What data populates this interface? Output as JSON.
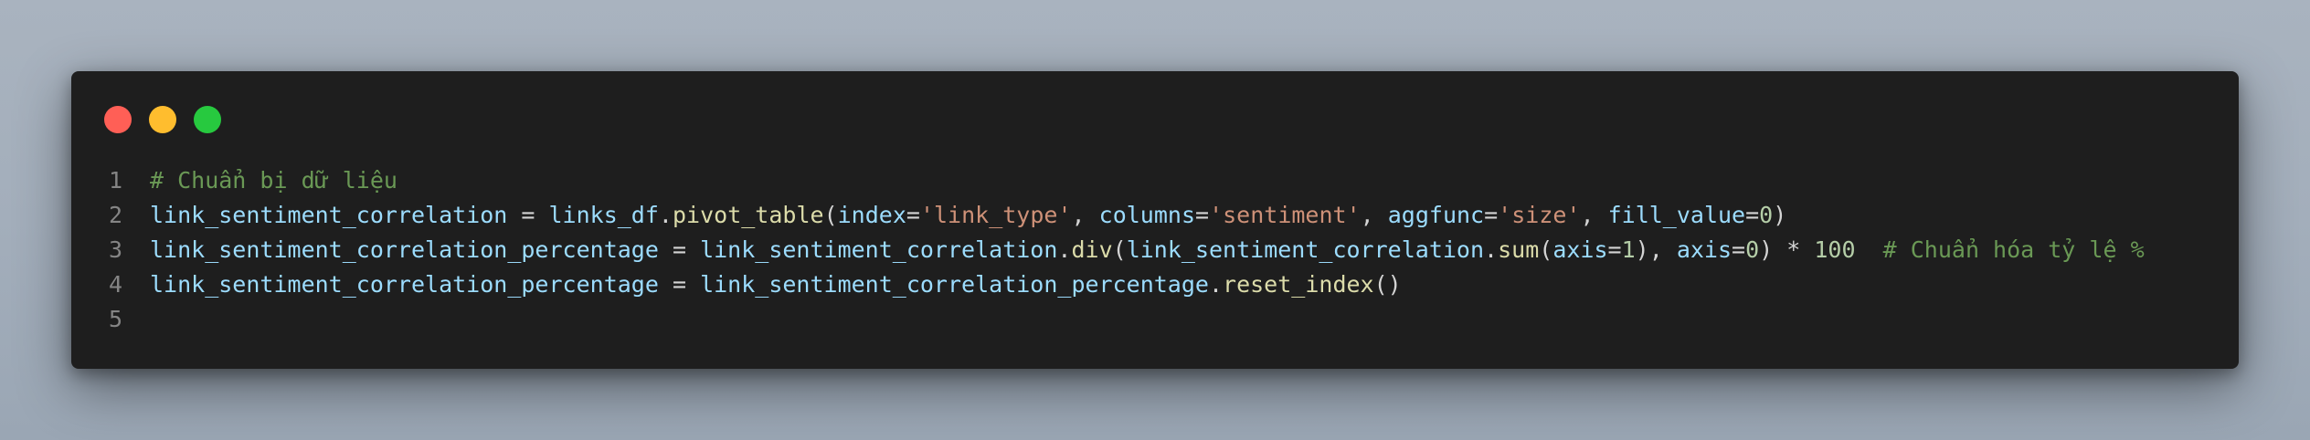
{
  "window": {
    "controls": [
      {
        "name": "close",
        "color": "#ff5f56"
      },
      {
        "name": "minimize",
        "color": "#ffbd2e"
      },
      {
        "name": "maximize",
        "color": "#27c93f"
      }
    ]
  },
  "colors": {
    "comment": "#6a9955",
    "variable": "#9cdcfe",
    "function": "#dcdcaa",
    "string": "#ce9178",
    "number": "#b5cea8",
    "plain": "#d4d4d4",
    "line_number": "#858585",
    "editor_bg": "#1e1e1e"
  },
  "code": {
    "lines": [
      {
        "number": "1",
        "tokens": [
          {
            "t": "# Chuẩn bị dữ liệu",
            "k": "com"
          }
        ]
      },
      {
        "number": "2",
        "tokens": [
          {
            "t": "link_sentiment_correlation",
            "k": "var"
          },
          {
            "t": " = ",
            "k": "op"
          },
          {
            "t": "links_df",
            "k": "var"
          },
          {
            "t": ".",
            "k": "op"
          },
          {
            "t": "pivot_table",
            "k": "fn"
          },
          {
            "t": "(",
            "k": "op"
          },
          {
            "t": "index",
            "k": "var"
          },
          {
            "t": "=",
            "k": "op"
          },
          {
            "t": "'link_type'",
            "k": "str"
          },
          {
            "t": ", ",
            "k": "op"
          },
          {
            "t": "columns",
            "k": "var"
          },
          {
            "t": "=",
            "k": "op"
          },
          {
            "t": "'sentiment'",
            "k": "str"
          },
          {
            "t": ", ",
            "k": "op"
          },
          {
            "t": "aggfunc",
            "k": "var"
          },
          {
            "t": "=",
            "k": "op"
          },
          {
            "t": "'size'",
            "k": "str"
          },
          {
            "t": ", ",
            "k": "op"
          },
          {
            "t": "fill_value",
            "k": "var"
          },
          {
            "t": "=",
            "k": "op"
          },
          {
            "t": "0",
            "k": "num"
          },
          {
            "t": ")",
            "k": "op"
          }
        ]
      },
      {
        "number": "3",
        "tokens": [
          {
            "t": "link_sentiment_correlation_percentage",
            "k": "var"
          },
          {
            "t": " = ",
            "k": "op"
          },
          {
            "t": "link_sentiment_correlation",
            "k": "var"
          },
          {
            "t": ".",
            "k": "op"
          },
          {
            "t": "div",
            "k": "fn"
          },
          {
            "t": "(",
            "k": "op"
          },
          {
            "t": "link_sentiment_correlation",
            "k": "var"
          },
          {
            "t": ".",
            "k": "op"
          },
          {
            "t": "sum",
            "k": "fn"
          },
          {
            "t": "(",
            "k": "op"
          },
          {
            "t": "axis",
            "k": "var"
          },
          {
            "t": "=",
            "k": "op"
          },
          {
            "t": "1",
            "k": "num"
          },
          {
            "t": "), ",
            "k": "op"
          },
          {
            "t": "axis",
            "k": "var"
          },
          {
            "t": "=",
            "k": "op"
          },
          {
            "t": "0",
            "k": "num"
          },
          {
            "t": ") * ",
            "k": "op"
          },
          {
            "t": "100",
            "k": "num"
          },
          {
            "t": "  ",
            "k": "op"
          },
          {
            "t": "# Chuẩn hóa tỷ lệ %",
            "k": "com"
          }
        ]
      },
      {
        "number": "4",
        "tokens": [
          {
            "t": "link_sentiment_correlation_percentage",
            "k": "var"
          },
          {
            "t": " = ",
            "k": "op"
          },
          {
            "t": "link_sentiment_correlation_percentage",
            "k": "var"
          },
          {
            "t": ".",
            "k": "op"
          },
          {
            "t": "reset_index",
            "k": "fn"
          },
          {
            "t": "()",
            "k": "op"
          }
        ]
      },
      {
        "number": "5",
        "tokens": []
      }
    ]
  }
}
